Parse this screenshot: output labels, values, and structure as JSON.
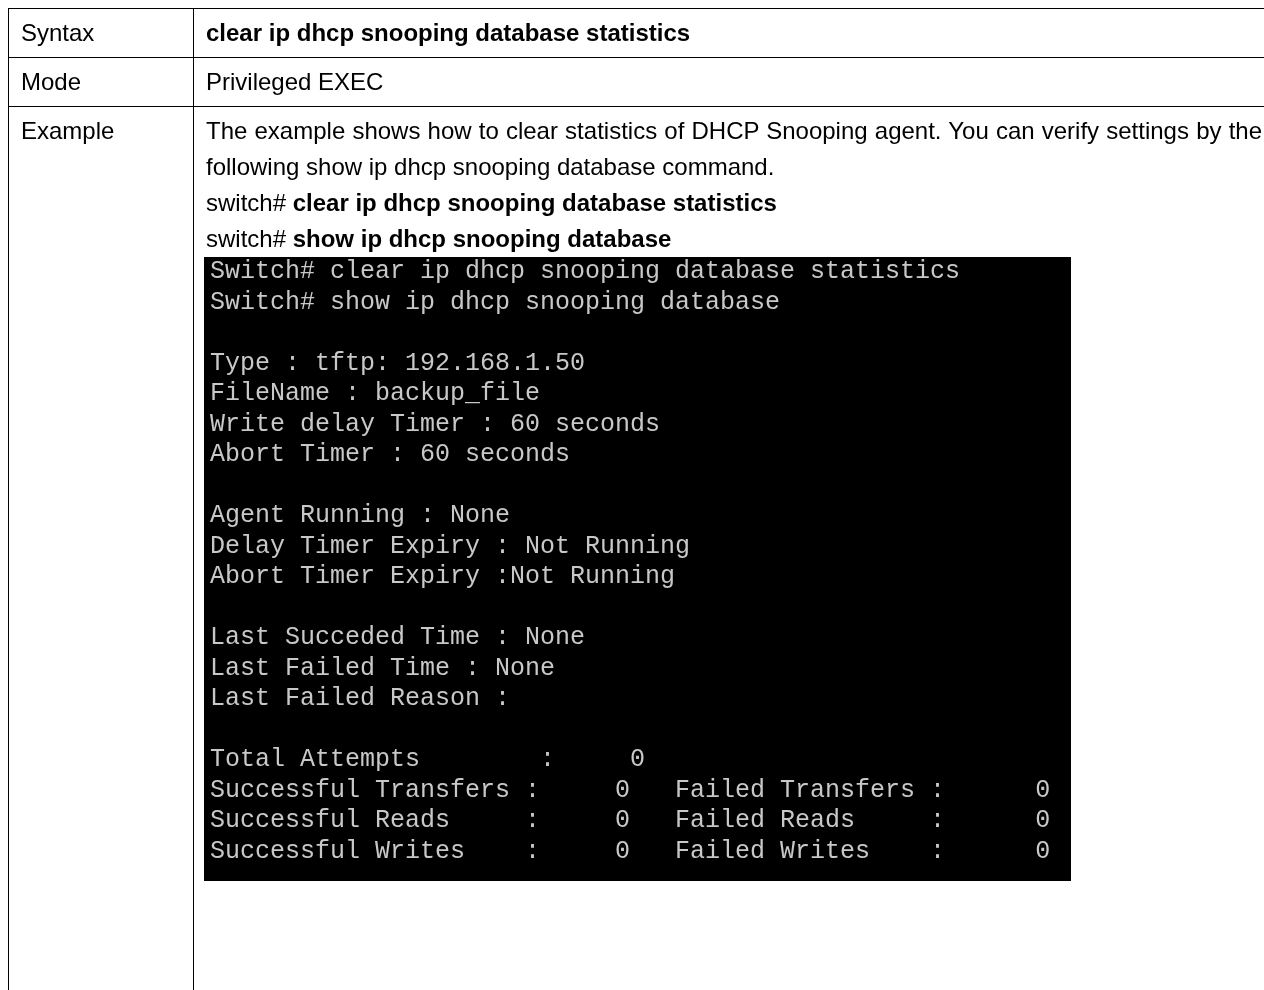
{
  "table": {
    "rows": [
      {
        "label": "Syntax",
        "content": [
          {
            "kind": "command",
            "text": "clear ip dhcp snooping database statistics"
          }
        ]
      },
      {
        "label": "Mode",
        "content": [
          {
            "kind": "text",
            "text": "Privileged EXEC"
          }
        ]
      },
      {
        "label": "Example",
        "content": [
          {
            "kind": "paragraph",
            "text": "The example shows how to clear statistics of DHCP Snooping agent. You can verify settings by the following show ip dhcp snooping database command."
          },
          {
            "kind": "text",
            "text": "switch# **clear ip dhcp snooping database statistics**"
          },
          {
            "kind": "text",
            "text": "switch# **show ip dhcp snooping database**"
          },
          {
            "kind": "terminal",
            "blocks": [
              [
                "Switch# clear ip dhcp snooping database statistics",
                "Switch# show ip dhcp snooping database"
              ],
              [
                "Type : tftp: 192.168.1.50",
                "FileName : backup_file",
                "Write delay Timer : 60 seconds",
                "Abort Timer : 60 seconds"
              ],
              [
                "Agent Running : None",
                "Delay Timer Expiry : Not Running",
                "Abort Timer Expiry :Not Running"
              ],
              [
                "Last Succeded Time : None",
                "Last Failed Time : None",
                "Last Failed Reason :"
              ],
              [
                "Total Attempts        :     0",
                "Successful Transfers :     0   Failed Transfers :      0",
                "Successful Reads     :     0   Failed Reads     :      0",
                "Successful Writes    :     0   Failed Writes    :      0"
              ]
            ]
          }
        ]
      }
    ]
  }
}
